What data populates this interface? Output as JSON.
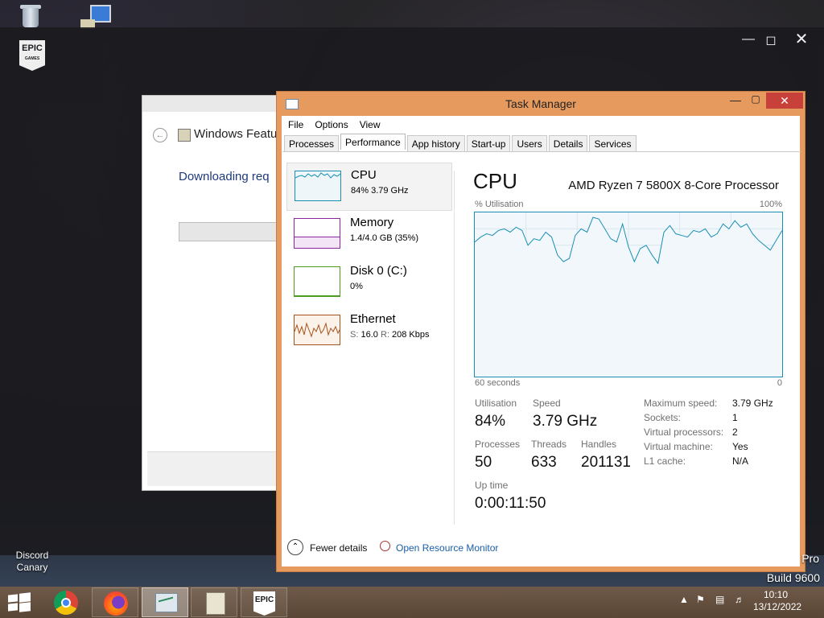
{
  "desktop": {
    "discord_label_1": "Discord",
    "discord_label_2": "Canary",
    "watermark_edition": "Pro",
    "watermark_build": "Build 9600"
  },
  "epic": {
    "logo_top": "EPIC",
    "logo_bottom": "GAMES"
  },
  "features_dialog": {
    "title": "Windows Featu",
    "status": "Downloading req"
  },
  "task_manager": {
    "title": "Task Manager",
    "menu": [
      "File",
      "Options",
      "View"
    ],
    "tabs": [
      "Processes",
      "Performance",
      "App history",
      "Start-up",
      "Users",
      "Details",
      "Services"
    ],
    "active_tab": "Performance",
    "resources": [
      {
        "name": "CPU",
        "value": "84% 3.79 GHz",
        "color": "#1a8fb4"
      },
      {
        "name": "Memory",
        "value": "1.4/4.0 GB (35%)",
        "color": "#8b26a0"
      },
      {
        "name": "Disk 0 (C:)",
        "value": "0%",
        "color": "#4c9b1c"
      },
      {
        "name": "Ethernet",
        "value_prefix_s": "S:",
        "value_s": "16.0",
        "value_prefix_r": "R:",
        "value_r": "208 Kbps",
        "color": "#a7521a"
      }
    ],
    "detail": {
      "heading": "CPU",
      "model": "AMD Ryzen 7 5800X 8-Core Processor",
      "graph_ylabel": "% Utilisation",
      "graph_ymax": "100%",
      "graph_x_left": "60 seconds",
      "graph_x_right": "0",
      "stats": {
        "utilisation_label": "Utilisation",
        "utilisation": "84%",
        "speed_label": "Speed",
        "speed": "3.79 GHz",
        "processes_label": "Processes",
        "processes": "50",
        "threads_label": "Threads",
        "threads": "633",
        "handles_label": "Handles",
        "handles": "201131",
        "uptime_label": "Up time",
        "uptime": "0:00:11:50"
      },
      "specs": [
        {
          "k": "Maximum speed:",
          "v": "3.79 GHz"
        },
        {
          "k": "Sockets:",
          "v": "1"
        },
        {
          "k": "Virtual processors:",
          "v": "2"
        },
        {
          "k": "Virtual machine:",
          "v": "Yes"
        },
        {
          "k": "L1 cache:",
          "v": "N/A"
        }
      ]
    },
    "footer": {
      "fewer_details": "Fewer details",
      "resource_monitor": "Open Resource Monitor"
    }
  },
  "chart_data": {
    "type": "line",
    "ylim": [
      0,
      100
    ],
    "xlim": [
      60,
      0
    ],
    "grid": true,
    "values": [
      82,
      85,
      87,
      86,
      89,
      90,
      88,
      91,
      89,
      80,
      84,
      83,
      88,
      85,
      74,
      70,
      72,
      86,
      90,
      88,
      97,
      96,
      90,
      84,
      82,
      93,
      79,
      70,
      78,
      80,
      74,
      69,
      88,
      92,
      87,
      86,
      85,
      89,
      88,
      90,
      85,
      87,
      93,
      90,
      95,
      91,
      93,
      87,
      83,
      80,
      77,
      83,
      89
    ]
  },
  "taskbar": {
    "time": "10:10",
    "date": "13/12/2022",
    "epic_label": "EPIC"
  }
}
